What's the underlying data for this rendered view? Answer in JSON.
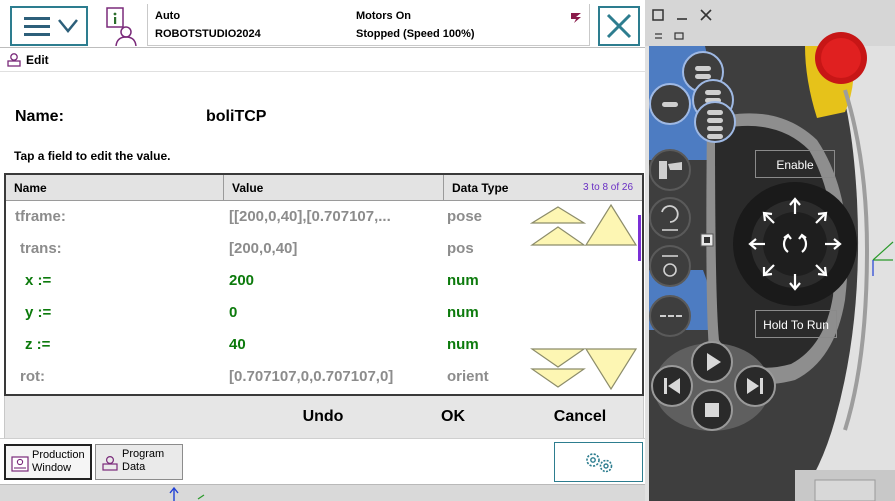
{
  "topbar": {
    "mode": "Auto",
    "system_name": "ROBOTSTUDIO2024",
    "motors": "Motors On",
    "state": "Stopped (Speed 100%)"
  },
  "edit_bar": {
    "title": "Edit"
  },
  "record": {
    "name_label": "Name:",
    "name_value": "boliTCP",
    "hint": "Tap a field to edit the value."
  },
  "table": {
    "headers": [
      "Name",
      "Value",
      "Data Type"
    ],
    "range": "3 to 8 of 26",
    "rows": [
      {
        "name": "tframe:",
        "value": "[[200,0,40],[0.707107,...",
        "type": "pose"
      },
      {
        "name": "trans:",
        "value": "[200,0,40]",
        "type": "pos"
      },
      {
        "name": "x :=",
        "value": "200",
        "type": "num"
      },
      {
        "name": "y :=",
        "value": "0",
        "type": "num"
      },
      {
        "name": "z :=",
        "value": "40",
        "type": "num"
      },
      {
        "name": "rot:",
        "value": "[0.707107,0,0.707107,0]",
        "type": "orient"
      }
    ]
  },
  "commands": {
    "undo": "Undo",
    "ok": "OK",
    "cancel": "Cancel"
  },
  "taskbar": {
    "production_window": [
      "Production",
      "Window"
    ],
    "program_data": [
      "Program",
      "Data"
    ]
  },
  "device": {
    "enable": "Enable",
    "hold_to_run": "Hold To Run"
  },
  "colors": {
    "accent": "#2d7d8f",
    "value_green": "#0c7a0c",
    "muted_gray": "#8c8c8c",
    "range_purple": "#6a2fc4",
    "arrow_yellow": "#fdf6b3",
    "device_blue": "#4d7cc2",
    "device_dark": "#3e3e3e",
    "estop_red": "#d41a1a"
  },
  "icons": {
    "menu": "hamburger-chevron-icon",
    "info": "event-log-icon",
    "close": "close-x-icon",
    "settings": "gears-icon"
  }
}
